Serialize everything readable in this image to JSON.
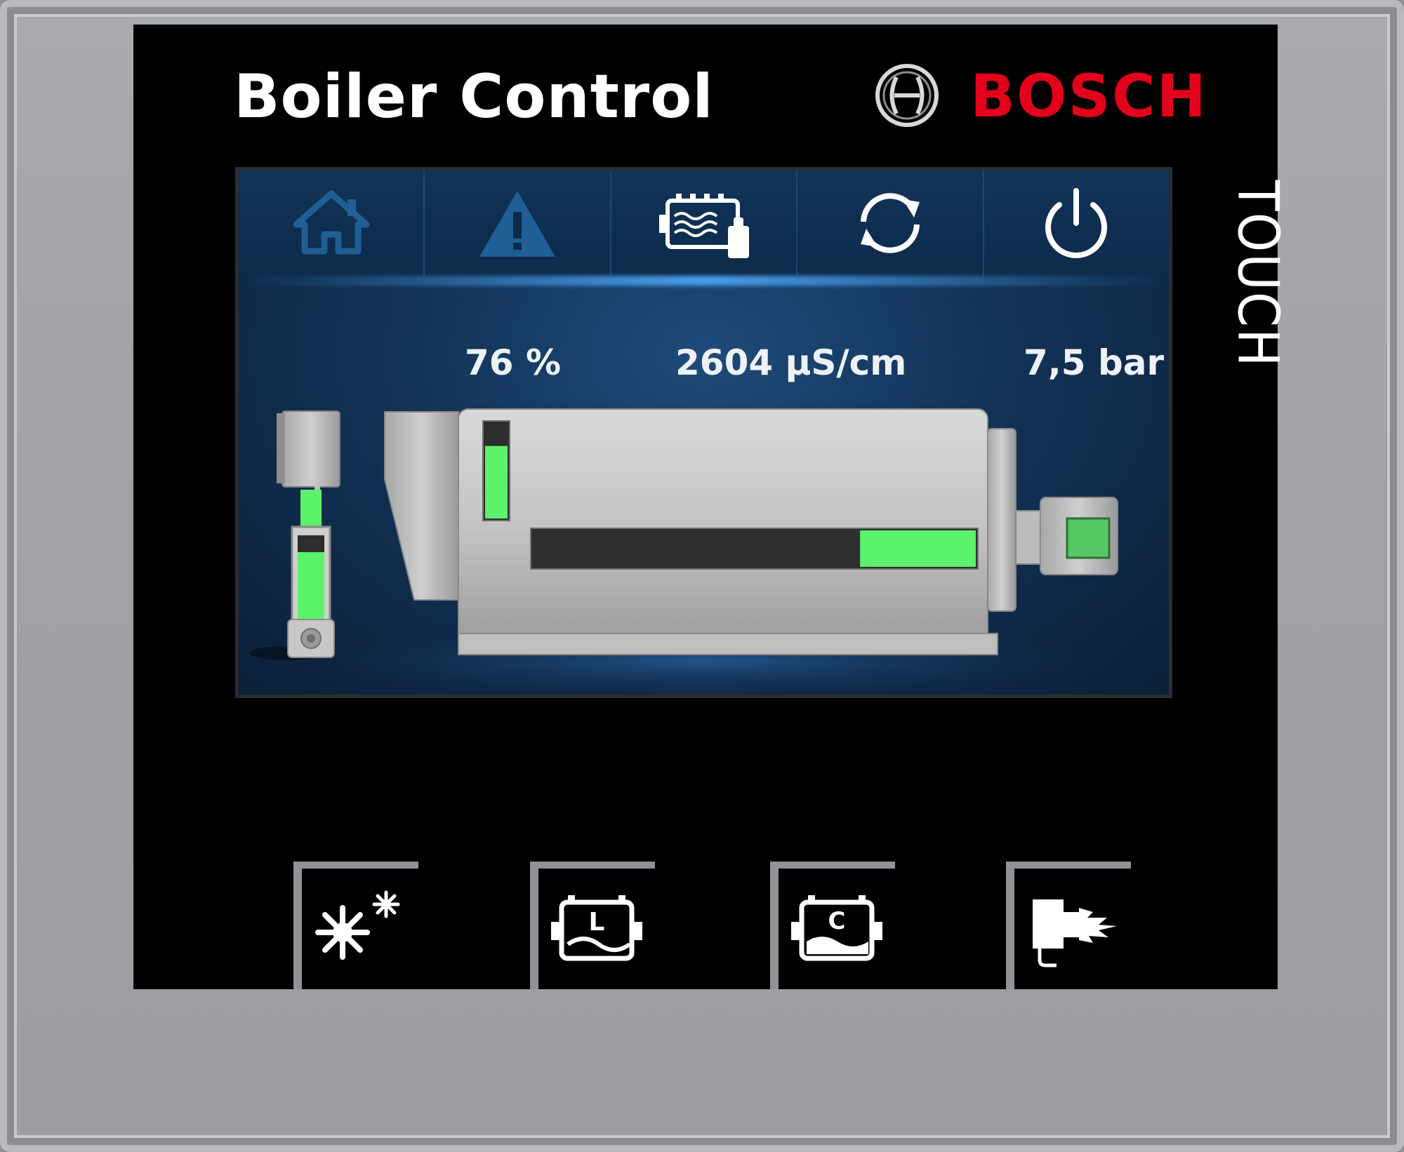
{
  "header": {
    "title": "Boiler Control",
    "brand": "BOSCH",
    "brand_color": "#e2001a",
    "touch_label": "TOUCH"
  },
  "nav": {
    "items": [
      {
        "name": "home-icon",
        "active": false
      },
      {
        "name": "warning-icon",
        "active": false
      },
      {
        "name": "boiler-overview-icon",
        "active": true
      },
      {
        "name": "refresh-icon",
        "active": false
      },
      {
        "name": "power-icon",
        "active": false
      }
    ]
  },
  "readings": {
    "level": "76 %",
    "conductivity": "2604 µS/cm",
    "pressure": "7,5 bar"
  },
  "indicators": {
    "pump_level_fraction": 0.8,
    "boiler_level_fraction": 0.76,
    "water_bar_fraction": 0.26
  },
  "colors": {
    "indicator_green": "#5cf26c",
    "inactive_icon": "#1f5f95",
    "active_icon": "#ffffff"
  },
  "softkeys": [
    {
      "name": "settings-key"
    },
    {
      "name": "level-key"
    },
    {
      "name": "conductivity-key"
    },
    {
      "name": "burner-key"
    }
  ]
}
